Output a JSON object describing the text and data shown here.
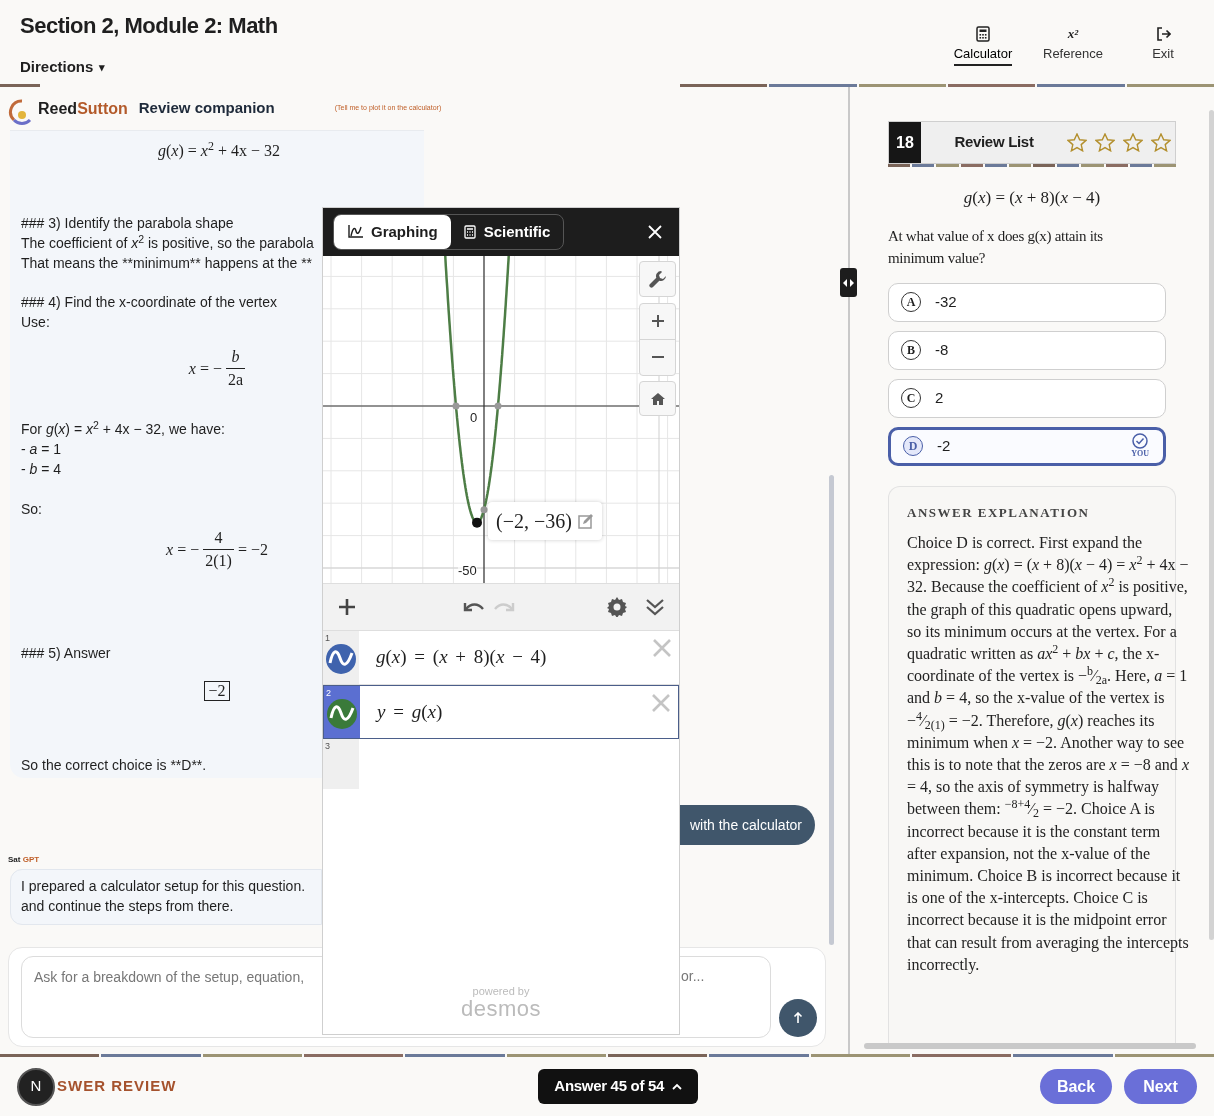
{
  "header": {
    "title": "Section 2, Module 2: Math",
    "directions": "Directions",
    "directions_caret": "▾",
    "tools": [
      {
        "kind": "calculator",
        "label": "Calculator",
        "selected": true
      },
      {
        "kind": "reference",
        "label": "Reference",
        "icon_text": "x²",
        "selected": false
      },
      {
        "kind": "exit",
        "label": "Exit",
        "selected": false
      }
    ]
  },
  "companion": {
    "brand_first": "Reed",
    "brand_second": "Sutton",
    "title": "Review companion",
    "hint": "(Tell me to plot it on the calculator)"
  },
  "chat": {
    "blocks": [
      {
        "kind": "math",
        "text": "*g*(*x*) = *x*$^{2}$ + 4x − 32"
      },
      {
        "kind": "heading",
        "text": "### 3) Identify the parabola shape"
      },
      {
        "kind": "rich",
        "text": "The coefficient of *x*$^{2}$ is positive, so the parabola"
      },
      {
        "kind": "plain",
        "text": "That means the **minimum** happens at the **"
      },
      {
        "kind": "heading",
        "text": "### 4) Find the x-coordinate of the vertex"
      },
      {
        "kind": "plain",
        "text": "Use:"
      },
      {
        "kind": "fraction",
        "lhs": "*x* = −",
        "num": "*b*",
        "den": "2a"
      },
      {
        "kind": "rich",
        "text": "For *g*(*x*) = *x*$^{2}$ + 4x − 32, we have:"
      },
      {
        "kind": "rich",
        "text": "- *a* = 1"
      },
      {
        "kind": "rich",
        "text": "- *b* = 4"
      },
      {
        "kind": "plain",
        "text": "So:"
      },
      {
        "kind": "fraction",
        "lhs": "*x* = −",
        "num": "4",
        "den": "2(1)",
        "rhs": "= −2"
      },
      {
        "kind": "heading",
        "text": "### 5) Answer"
      },
      {
        "kind": "boxed",
        "text": "−2"
      },
      {
        "kind": "plain",
        "text": "So the correct choice is **D**."
      }
    ],
    "action": "with the calculator",
    "sender_first": "Sat",
    "sender_second": "GPT",
    "message_lines": [
      "I prepared a calculator setup for this question.",
      "and continue the steps from there."
    ],
    "placeholder": "Ask for a breakdown of the setup, equation,",
    "placeholder_tail": "or..."
  },
  "calculator": {
    "tabs": [
      {
        "kind": "graphing",
        "label": "Graphing",
        "selected": true
      },
      {
        "kind": "scientific",
        "label": "Scientific",
        "selected": false
      }
    ],
    "axis_labels": {
      "origin": "0",
      "y_tick": "-50"
    },
    "point_label": "(−2, −36)",
    "expressions": [
      {
        "number": "1",
        "text": "*g*(*x*) = (*x* + 8)(*x* − 4)",
        "color": "#3f63ad",
        "selected": false
      },
      {
        "number": "2",
        "text": "*y* = *g*(*x*)",
        "color": "#3a7a3a",
        "selected": true
      },
      {
        "number": "3"
      }
    ],
    "powered_by": "powered by",
    "brand": "desmos"
  },
  "question": {
    "number": "18",
    "review_label": "Review List",
    "stars": 0,
    "equation": "*g*(*x*) = (*x* + 8)(*x* − 4)",
    "prompt": "At what value of x does g(x) attain its minimum value?",
    "choices": [
      {
        "letter": "A",
        "text": "-32",
        "selected": false
      },
      {
        "letter": "B",
        "text": "-8",
        "selected": false
      },
      {
        "letter": "C",
        "text": "2",
        "selected": false
      },
      {
        "letter": "D",
        "text": "-2",
        "selected": true
      }
    ],
    "you_label": "YOU",
    "explanation_title": "ANSWER EXPLANATION",
    "explanation": "Choice D is correct. First expand the expression: *g*(*x*) = (*x* + 8)(*x* − 4) = *x*$^{2}$ + 4x − 32. Because the coefficient of *x*$^{2}$ is positive, the graph of this quadratic opens upward, so its minimum occurs at the vertex. For a quadratic written as *ax*$^{2}$ + *bx* + *c*, the x-coordinate of the vertex is −$^{b}$⁄$_{2a}$. Here, *a* = 1 and *b* = 4, so the x-value of the vertex is −$^{4}$⁄$_{2(1)}$ = −2. Therefore, *g*(*x*) reaches its minimum when *x* = −2. Another way to see this is to note that the zeros are *x* = −8 and *x* = 4, so the axis of symmetry is halfway between them: $^{−8+4}$⁄$_{2}$ = −2. Choice A is incorrect because it is the constant term after expansion, not the x-value of the minimum. Choice B is incorrect because it is one of the x-intercepts. Choice C is incorrect because it is the midpoint error that can result from averaging the intercepts incorrectly."
  },
  "footer": {
    "avatar": "N",
    "mode": "SWER REVIEW",
    "progress": "Answer 45 of 54",
    "back": "Back",
    "next": "Next"
  }
}
